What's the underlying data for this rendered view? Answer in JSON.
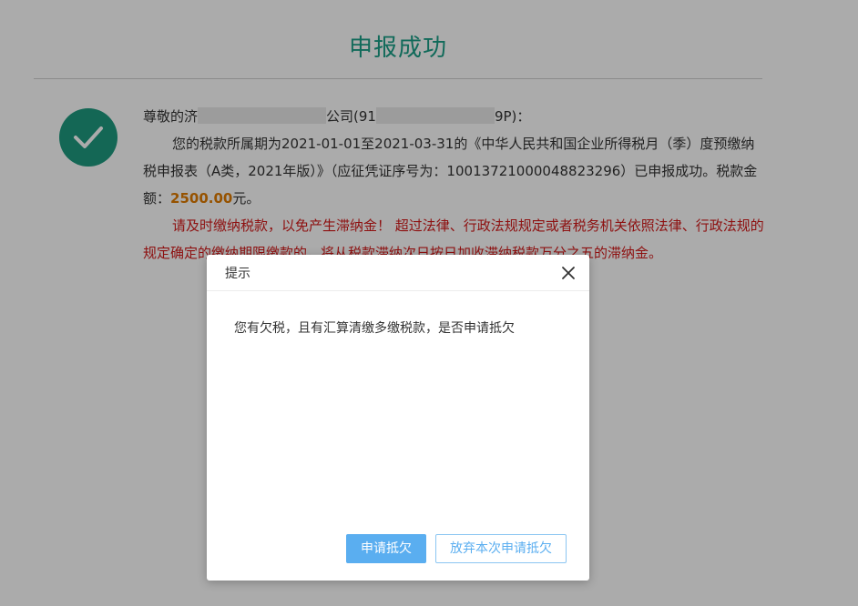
{
  "page": {
    "title": "申报成功",
    "greeting_prefix": "尊敬的济",
    "greeting_company_suffix": "公司(91",
    "greeting_id_suffix": "9P)：",
    "period_text": "您的税款所属期为2021-01-01至2021-03-31的《中华人民共和国企业所得税月（季）度预缴纳税申报表（A类，2021年版）》（应征凭证序号为：10013721000048823296）已申报成功。税款金额：",
    "amount": "2500.00",
    "amount_suffix": "元。",
    "warning": "请及时缴纳税款，以免产生滞纳金！ 超过法律、行政法规规定或者税务机关依照法律、行政法规的规定确定的缴纳期限缴款的，将从税款滞纳次日按日加收滞纳税款万分之五的滞纳金。"
  },
  "dialog": {
    "title": "提示",
    "message": "您有欠税，且有汇算清缴多缴税款，是否申请抵欠",
    "confirm_label": "申请抵欠",
    "cancel_label": "放弃本次申请抵欠"
  },
  "icons": {
    "success": "check-circle-icon",
    "close": "close-icon"
  },
  "colors": {
    "title": "#1a9f86",
    "success_icon": "#1e9a7f",
    "amount": "#e07b00",
    "warning": "#d41a1a",
    "primary_button": "#5aaef0"
  }
}
